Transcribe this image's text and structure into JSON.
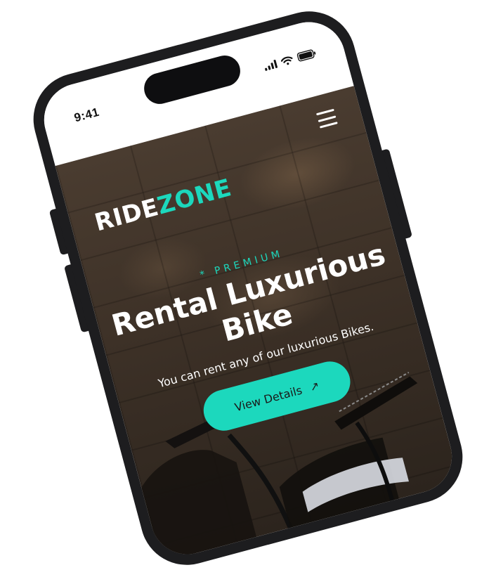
{
  "status_bar": {
    "time": "9:41"
  },
  "brand": {
    "part1": "RIDE",
    "part2": "ZONE",
    "accent_color": "#1cd8bd"
  },
  "hero": {
    "eyebrow": "* PREMIUM",
    "headline_line1": "Rental Luxurious",
    "headline_line2": "Bike",
    "subtitle": "You can rent any of our luxurious Bikes.",
    "cta_label": "View Details",
    "cta_icon": "arrow-up-right-icon"
  },
  "icons": {
    "menu": "hamburger-menu-icon",
    "signal": "signal-icon",
    "wifi": "wifi-icon",
    "battery": "battery-icon"
  }
}
